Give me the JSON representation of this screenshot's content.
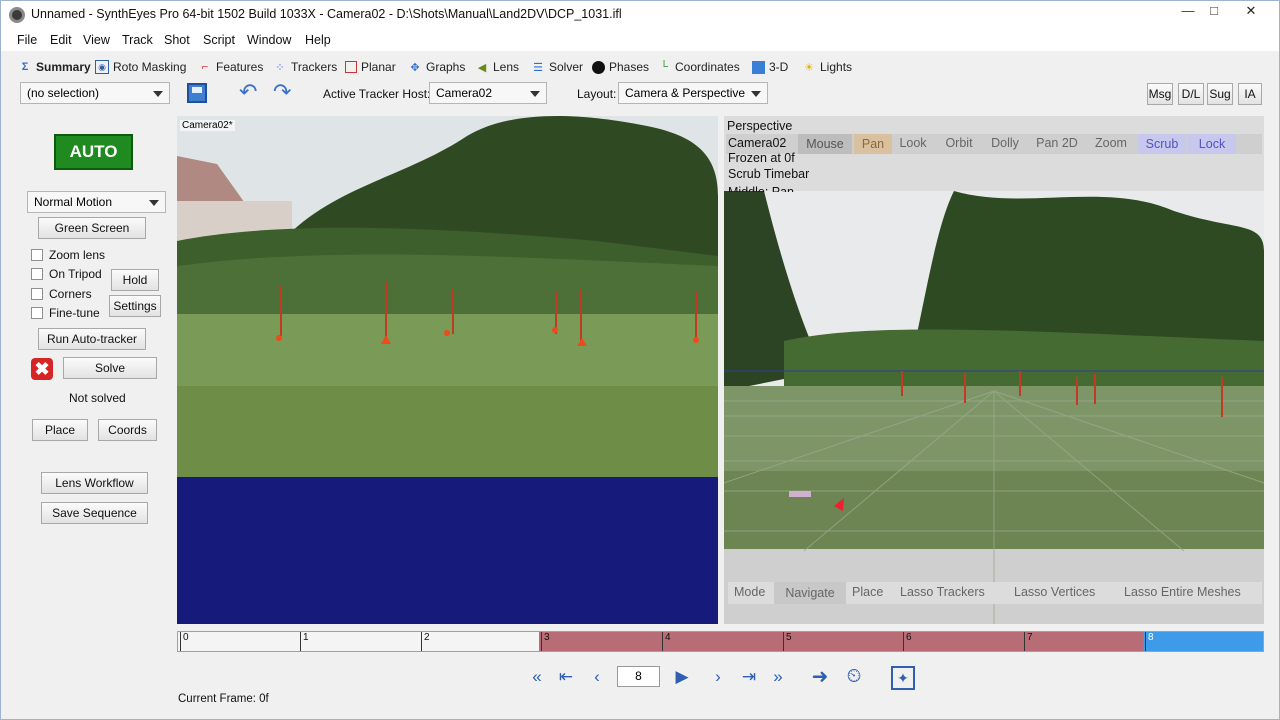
{
  "window": {
    "title": "Unnamed - SynthEyes Pro 64-bit 1502 Build 1033X - Camera02 - D:\\Shots\\Manual\\Land2DV\\DCP_1031.ifl"
  },
  "menu": [
    "File",
    "Edit",
    "View",
    "Track",
    "Shot",
    "Script",
    "Window",
    "Help"
  ],
  "rooms": [
    "Summary",
    "Roto Masking",
    "Features",
    "Trackers",
    "Planar",
    "Graphs",
    "Lens",
    "Solver",
    "Phases",
    "Coordinates",
    "3-D",
    "Lights"
  ],
  "toolbar": {
    "selection": "(no selection)",
    "tracker_host_label": "Active Tracker Host:",
    "tracker_host_value": "Camera02",
    "layout_label": "Layout:",
    "layout_value": "Camera & Perspective",
    "right_buttons": [
      "Msg",
      "D/L",
      "Sug",
      "IA"
    ]
  },
  "left_panel": {
    "auto": "AUTO",
    "motion": "Normal Motion",
    "green_screen": "Green Screen",
    "checks": [
      "Zoom lens",
      "On Tripod",
      "Corners",
      "Fine-tune"
    ],
    "hold": "Hold",
    "settings": "Settings",
    "run_auto_tracker": "Run Auto-tracker",
    "solve": "Solve",
    "status": "Not solved",
    "place": "Place",
    "coords": "Coords",
    "lens_workflow": "Lens Workflow",
    "save_sequence": "Save Sequence"
  },
  "camera_view": {
    "label": "Camera02*"
  },
  "perspective": {
    "title": "Perspective",
    "camera": "Camera02",
    "modes": [
      "Mouse",
      "Pan",
      "Look",
      "Orbit",
      "Dolly",
      "Pan 2D",
      "Zoom",
      "Scrub",
      "Lock"
    ],
    "frozen": "Frozen at 0f",
    "hint1": "Scrub Timebar",
    "hint2": "Middle: Pan",
    "bottom_modes": [
      "Mode",
      "Navigate",
      "Place",
      "Lasso Trackers",
      "Lasso Vertices",
      "Lasso Entire Meshes"
    ]
  },
  "timebar": {
    "ticks": [
      "0",
      "1",
      "2",
      "3",
      "4",
      "5",
      "6",
      "7",
      "8"
    ],
    "current": 8
  },
  "transport": {
    "frame_value": "8"
  },
  "status": {
    "current_frame": "Current Frame: 0f"
  },
  "colors": {
    "accent_green": "#1f8a1f",
    "timebar_red": "#b86d76",
    "timebar_blue": "#3d9be9",
    "view_bg": "#161a7a"
  }
}
